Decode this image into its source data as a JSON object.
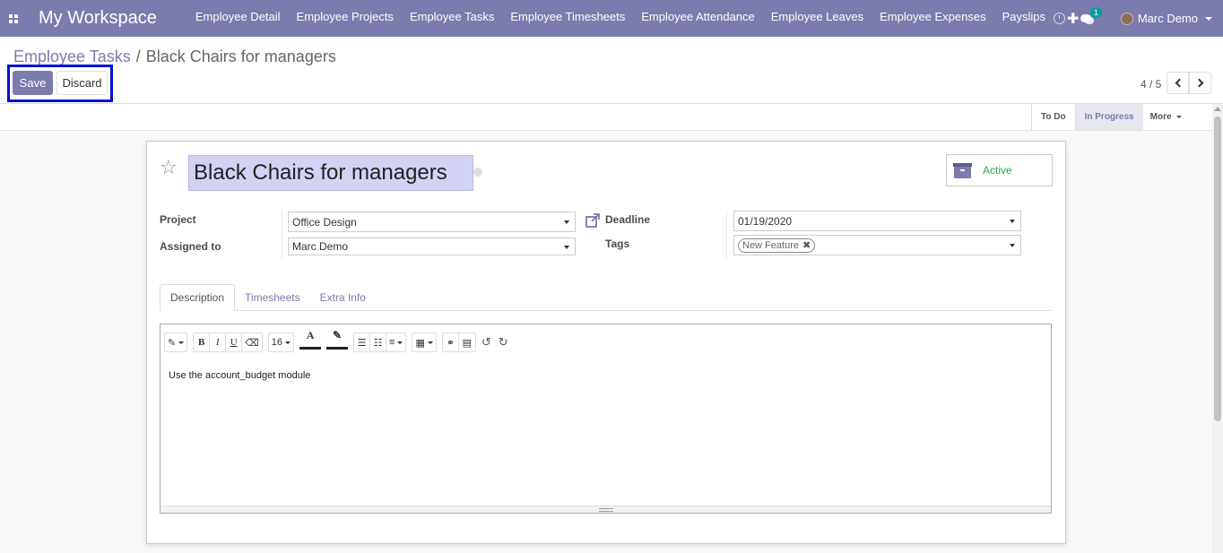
{
  "topnav": {
    "brand": "My Workspace",
    "menu": [
      "Employee Detail",
      "Employee Projects",
      "Employee Tasks",
      "Employee Timesheets",
      "Employee Attendance",
      "Employee Leaves",
      "Employee Expenses",
      "Payslips"
    ],
    "plus": "✚",
    "notification_count": "1",
    "user_name": "Marc Demo",
    "accent_color": "#7c7bad"
  },
  "breadcrumb": {
    "parent": "Employee Tasks",
    "separator": "/",
    "current": "Black Chairs for managers"
  },
  "buttons": {
    "save": "Save",
    "discard": "Discard"
  },
  "pager": {
    "value": "4 / 5"
  },
  "statusbar": {
    "stages": [
      "To Do",
      "In Progress"
    ],
    "active_stage": "In Progress",
    "more": "More"
  },
  "form": {
    "title": "Black Chairs for managers",
    "active_label": "Active",
    "fields": {
      "project_label": "Project",
      "project_value": "Office Design",
      "assigned_label": "Assigned to",
      "assigned_value": "Marc Demo",
      "deadline_label": "Deadline",
      "deadline_value": "01/19/2020",
      "tags_label": "Tags",
      "tag": "New Feature"
    },
    "tabs": [
      "Description",
      "Timesheets",
      "Extra Info"
    ],
    "active_tab": "Description",
    "editor": {
      "font_size": "16",
      "content": "Use the account_budget module"
    }
  }
}
